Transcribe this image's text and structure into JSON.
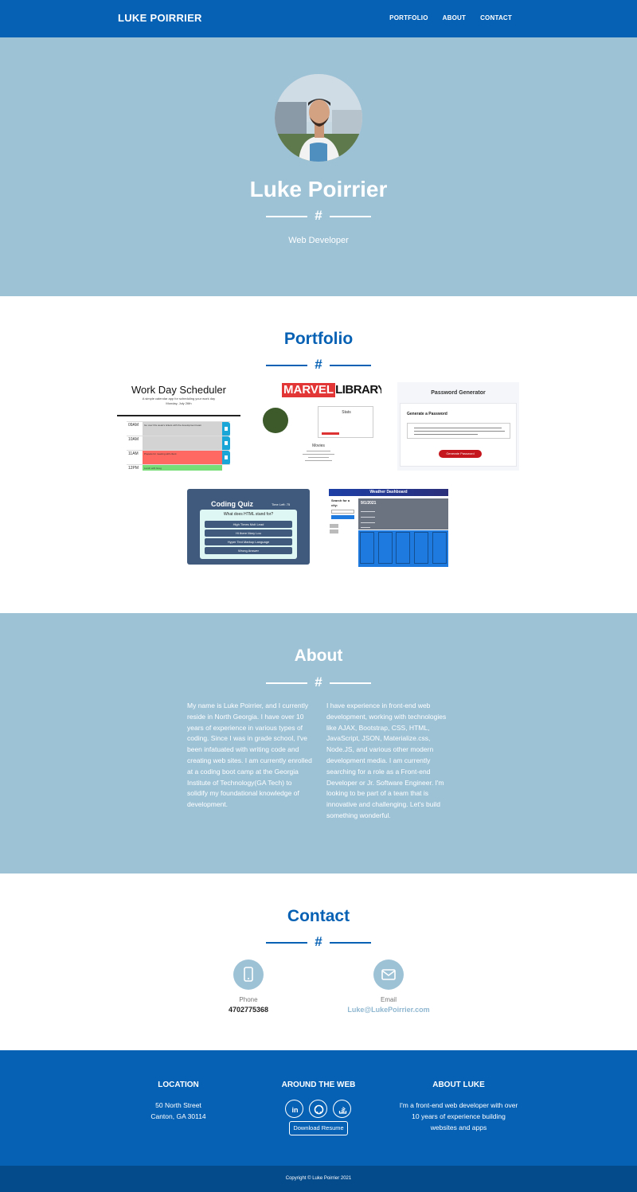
{
  "nav": {
    "brand": "LUKE POIRRIER",
    "links": [
      "PORTFOLIO",
      "ABOUT",
      "CONTACT"
    ]
  },
  "hero": {
    "name": "Luke Poirrier",
    "divider_icon": "#",
    "subtitle": "Web Developer",
    "avatar_icon": "profile-photo"
  },
  "portfolio": {
    "title": "Portfolio",
    "divider_icon": "#",
    "projects": {
      "scheduler": {
        "title": "Work Day Scheduler",
        "subtitle": "A simple calendar app for scheduling your work day",
        "date": "Monday, July 26th",
        "hours": [
          "09AM",
          "10AM",
          "11AM",
          "12PM"
        ],
        "entries": [
          "Go over this week's tickets with the development team",
          "",
          "Prepare for meeting with client",
          "Lunch with Greg"
        ]
      },
      "marvel": {
        "logo_red": "MARVEL",
        "logo_black": "LIBRARY",
        "stats_label": "Stats",
        "movies_label": "Movies"
      },
      "password": {
        "title": "Password Generator",
        "panel_title": "Generate a Password",
        "button": "Generate Password"
      },
      "quiz": {
        "title": "Coding Quiz",
        "time_left": "Time Left: 75",
        "question": "What does HTML stand for?",
        "answers": [
          "High Times Molt Lead",
          "Hi there Mary Lou",
          "Hyper Text Markup Language",
          "Wrong Answer"
        ]
      },
      "weather": {
        "title": "Weather Dashboard",
        "search_label": "Search for a city:",
        "date": "9/1/2021"
      }
    }
  },
  "about": {
    "title": "About",
    "divider_icon": "#",
    "col1": "My name is Luke Poirrier, and I currently reside in North Georgia. I have over 10 years of experience in various types of coding. Since I was in grade school, I've been infatuated with writing code and creating web sites. I am currently enrolled at a coding boot camp at the Georgia Institute of Technology(GA Tech) to solidify my foundational knowledge of development.",
    "col2": "I have experience in front-end web development, working with technologies like AJAX, Bootstrap, CSS, HTML, JavaScript, JSON, Materialize.css, Node.JS, and various other modern development media. I am currently searching for a role as a Front-end Developer or Jr. Software Engineer. I'm looking to be part of a team that is innovative and challenging. Let's build something wonderful."
  },
  "contact": {
    "title": "Contact",
    "divider_icon": "#",
    "phone_label": "Phone",
    "phone": "4702775368",
    "email_label": "Email",
    "email": "Luke@LukePoirrier.com"
  },
  "footer": {
    "location_title": "LOCATION",
    "address1": "50 North Street",
    "address2": "Canton, GA 30114",
    "web_title": "AROUND THE WEB",
    "social_icons": [
      "linkedin-icon",
      "github-icon",
      "stackoverflow-icon"
    ],
    "resume_button": "Download Resume",
    "about_title": "ABOUT LUKE",
    "about_text": "I'm a front-end web developer with over 10 years of experience building websites and apps",
    "copyright": "Copyright © Luke Poirrier 2021"
  },
  "colors": {
    "primary": "#0661b4",
    "hero_bg": "#9dc2d6",
    "copyright_bg": "#044b8c"
  }
}
